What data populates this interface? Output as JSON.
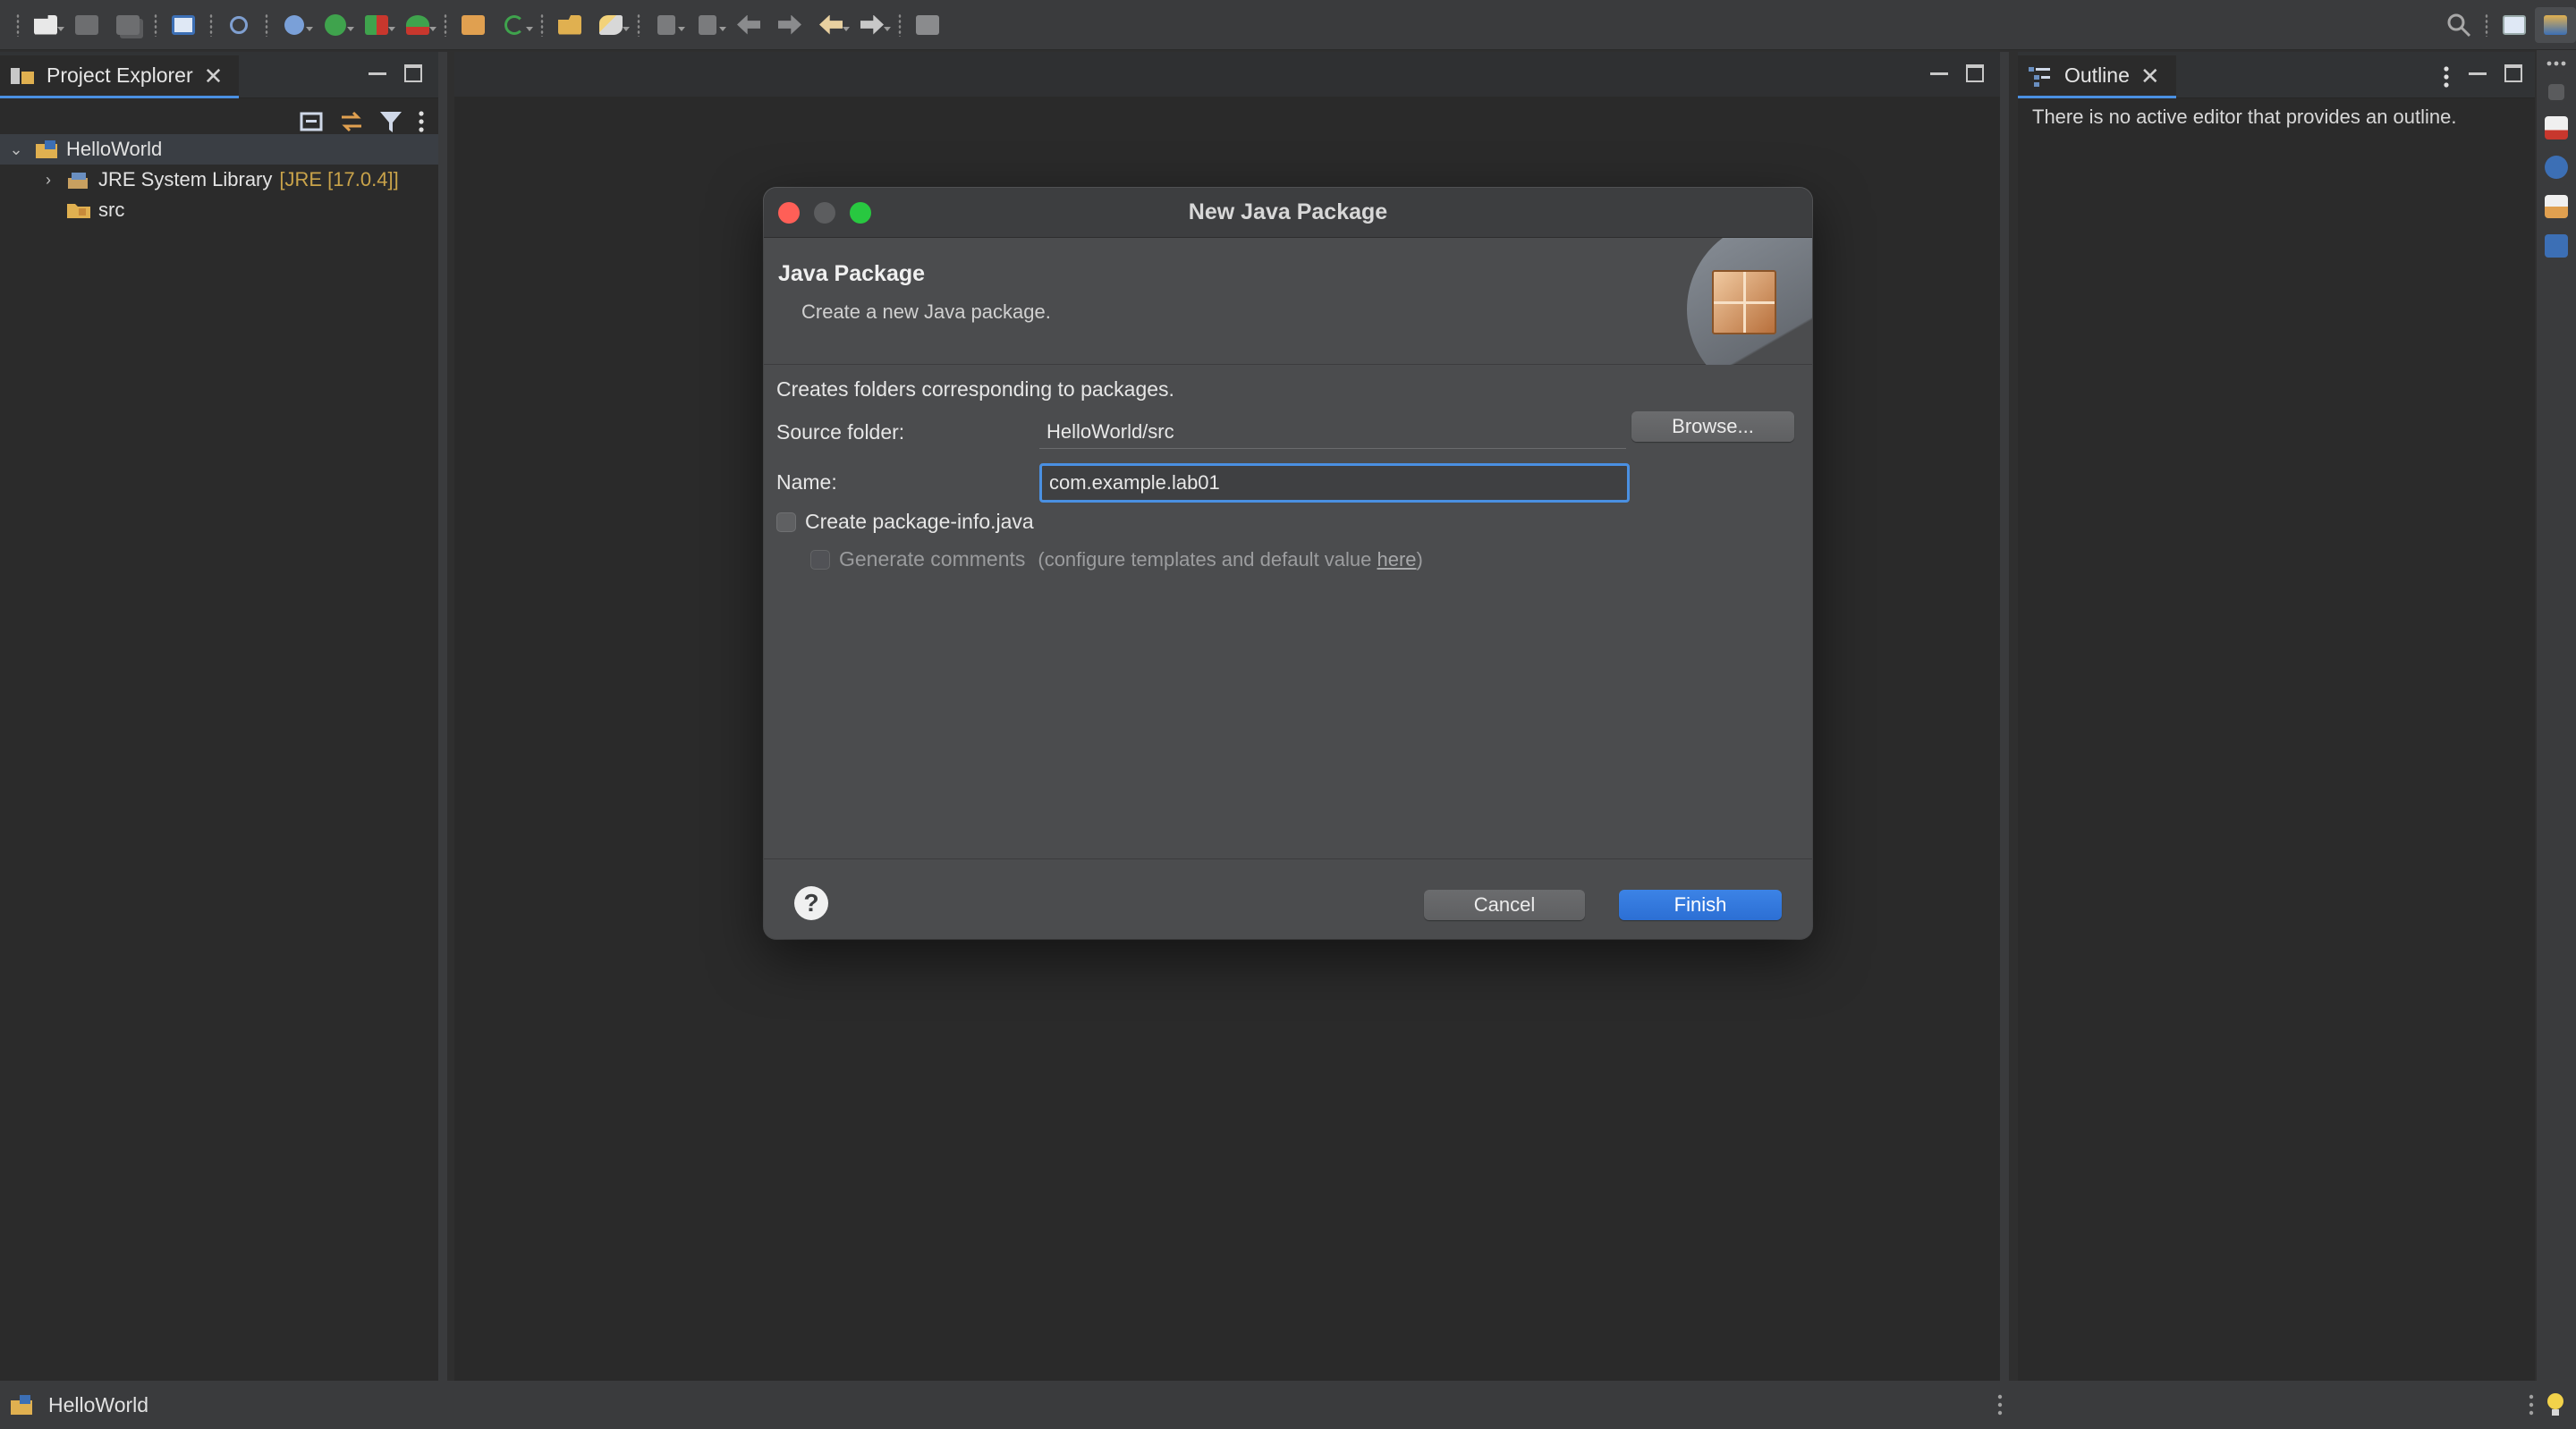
{
  "toolbar": {
    "icons": [
      "new-wizard-icon",
      "save-icon",
      "save-all-icon",
      "terminal-icon",
      "skip-breakpoints-icon",
      "debug-icon",
      "run-icon",
      "coverage-icon",
      "external-tools-icon",
      "new-java-class-icon",
      "refresh-icon",
      "open-type-icon",
      "search-icon",
      "next-annotation-icon",
      "prev-annotation-icon",
      "last-edit-icon",
      "back-icon",
      "forward-icon",
      "pin-icon"
    ]
  },
  "explorer": {
    "tab_label": "Project Explorer",
    "tree": {
      "project": "HelloWorld",
      "jre_label": "JRE System Library",
      "jre_decoration": "[JRE [17.0.4]]",
      "src_label": "src"
    }
  },
  "outline": {
    "tab_label": "Outline",
    "message": "There is no active editor that provides an outline."
  },
  "status": {
    "project": "HelloWorld"
  },
  "dialog": {
    "title": "New Java Package",
    "banner_title": "Java Package",
    "banner_desc": "Create a new Java package.",
    "description": "Creates folders corresponding to packages.",
    "source_folder_label": "Source folder:",
    "source_folder_value": "HelloWorld/src",
    "browse_label": "Browse...",
    "name_label": "Name:",
    "name_value": "com.example.lab01",
    "create_package_info_label": "Create package-info.java",
    "create_package_info_checked": false,
    "generate_comments_label": "Generate comments",
    "generate_comments_checked": false,
    "hint_prefix": "(configure templates and default value ",
    "hint_link": "here",
    "hint_suffix": ")",
    "help_symbol": "?",
    "cancel_label": "Cancel",
    "finish_label": "Finish"
  },
  "colors": {
    "accent": "#4a90e2",
    "primary_button": "#2f74dc",
    "traffic_red": "#ff5f57",
    "traffic_yellow": "#5c5d5f",
    "traffic_green": "#28c840",
    "decoration": "#c9a34a"
  }
}
